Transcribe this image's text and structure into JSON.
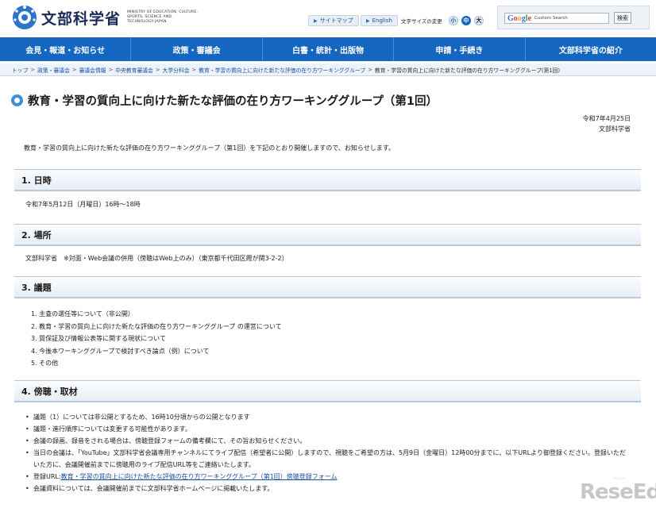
{
  "header": {
    "logo_text": "文部科学省",
    "logo_en": "MINISTRY OF EDUCATION, CULTURE, SPORTS, SCIENCE AND TECHNOLOGY-JAPAN",
    "sitemap": "サイトマップ",
    "english": "English",
    "font_size_label": "文字サイズの変更",
    "font_small": "小",
    "font_medium": "中",
    "font_large": "大",
    "search_placeholder": "Custom Search",
    "google": "Google",
    "search_button": "検索"
  },
  "nav": {
    "items": [
      "会見・報道・お知らせ",
      "政策・審議会",
      "白書・統計・出版物",
      "申請・手続き",
      "文部科学省の紹介"
    ]
  },
  "breadcrumb": {
    "links": [
      "トップ",
      "政策・審議会",
      "審議会情報",
      "中央教育審議会",
      "大学分科会",
      "教育・学習の質向上に向けた新たな評価の在り方ワーキンググループ"
    ],
    "current": "教育・学習の質向上に向けた新たな評価の在り方ワーキンググループ(第1回)",
    "separator": ">"
  },
  "page": {
    "title": "教育・学習の質向上に向けた新たな評価の在り方ワーキンググループ（第1回）",
    "date": "令和7年4月25日",
    "org": "文部科学省",
    "intro": "教育・学習の質向上に向けた新たな評価の在り方ワーキンググループ（第1回）を下記のとおり開催しますので、お知らせします。"
  },
  "sections": {
    "datetime": {
      "heading": "1. 日時",
      "text": "令和7年5月12日（月曜日）16時～18時"
    },
    "place": {
      "heading": "2. 場所",
      "text": "文部科学省　※対面・Web会議の併用（傍聴はWeb上のみ）（東京都千代田区霞が関3-2-2）"
    },
    "agenda": {
      "heading": "3. 議題",
      "items": [
        "1. 主査の選任等について（非公開）",
        "2. 教育・学習の質向上に向けた新たな評価の在り方ワーキンググループ の運営について",
        "3. 質保証及び情報公表等に関する現状について",
        "4. 今後本ワーキンググループで検討すべき論点（例）について",
        "5. その他"
      ]
    },
    "observe": {
      "heading": "4. 傍聴・取材",
      "bullet": "•",
      "items": [
        "議題（1）については非公開とするため、16時10分頃からの公開となります",
        "議題・進行順序については変更する可能性があります。",
        "会議の録画、録音をされる場合は、傍聴登録フォームの備考欄にて、その旨お知らせください。",
        "当日の会議は、「YouTube」文部科学省会議専用チャンネルにてライブ配信（希望者に公開）しますので、視聴をご希望の方は、5月9日（金曜日）12時00分までに、以下URLより御登録ください。登録いただいた方に、会議開催前までに傍聴用のライブ配信URL等をご連絡いたします。"
      ],
      "url_label": "登録URL:",
      "url_link": "教育・学習の質向上に向けた新たな評価の在り方ワーキンググループ（第1回）傍聴登録フォーム",
      "last_item": "会議資料については、会議開催前までに文部科学省ホームページに掲載いたします。"
    }
  },
  "watermark": {
    "text": "ReseEd",
    "small": "リシード"
  },
  "colors": {
    "nav": "#1566c0",
    "link": "#1a50a6",
    "accent": "#3d8ed9"
  }
}
